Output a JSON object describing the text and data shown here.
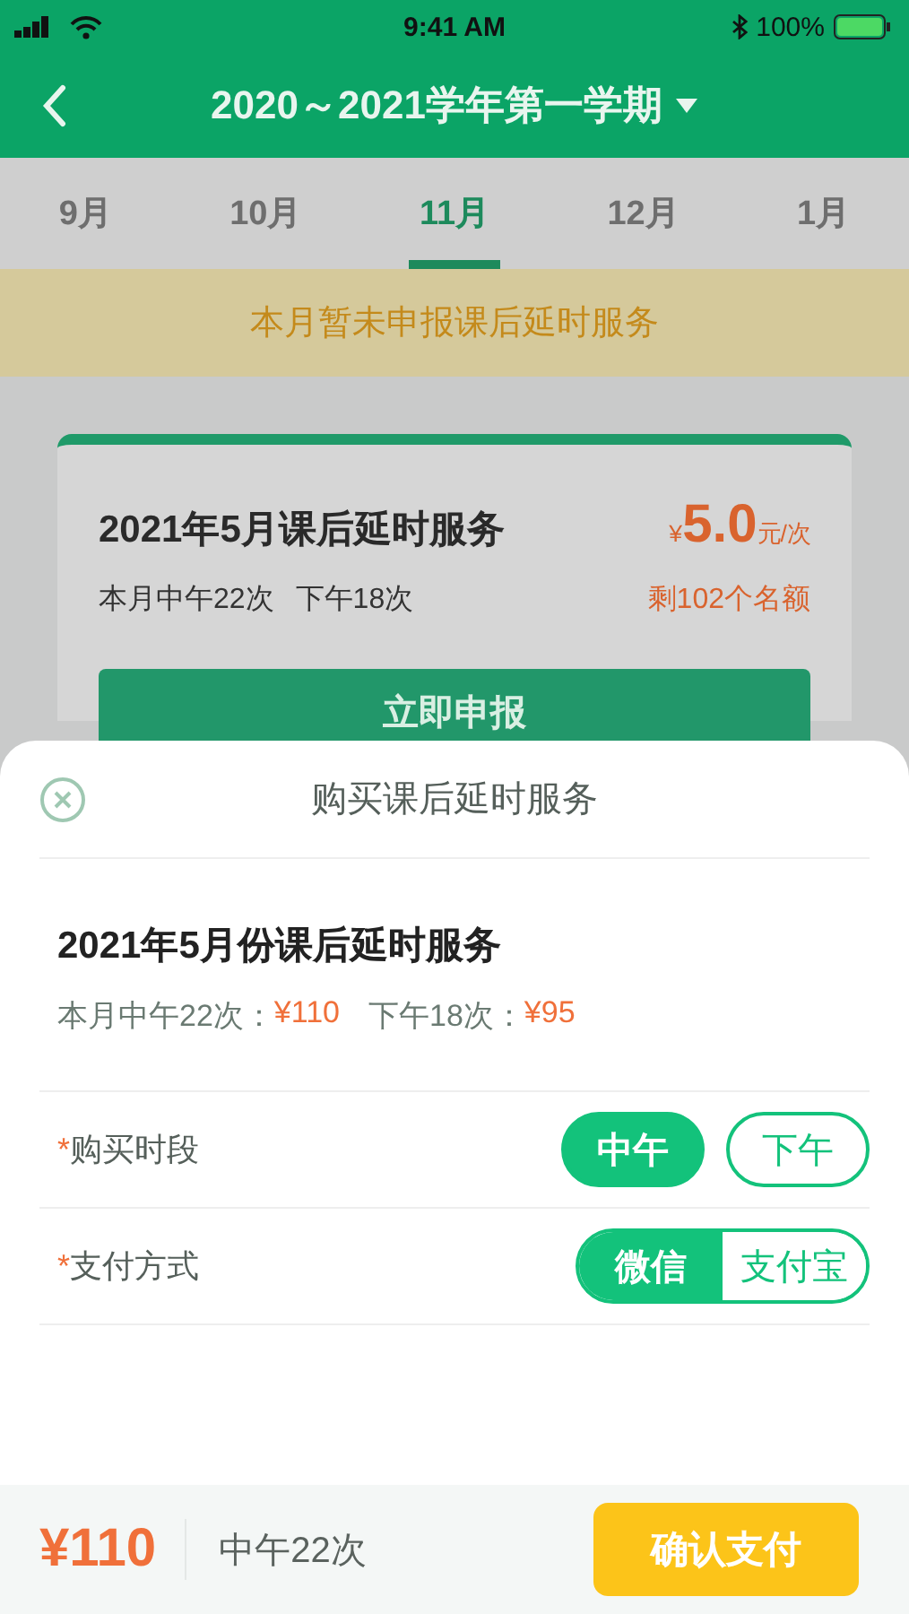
{
  "status_bar": {
    "time": "9:41 AM",
    "battery": "100%"
  },
  "header": {
    "title": "2020～2021学年第一学期"
  },
  "tabs": [
    {
      "label": "9月",
      "selected": false
    },
    {
      "label": "10月",
      "selected": false
    },
    {
      "label": "11月",
      "selected": true
    },
    {
      "label": "12月",
      "selected": false
    },
    {
      "label": "1月",
      "selected": false
    }
  ],
  "notice": "本月暂未申报课后延时服务",
  "card": {
    "title": "2021年5月课后延时服务",
    "currency": "¥",
    "amount": "5.0",
    "unit": "元/次",
    "counts": [
      "本月中午22次",
      "下午18次"
    ],
    "remaining": "剩102个名额",
    "button": "立即申报"
  },
  "sheet": {
    "title": "购买课后延时服务",
    "item_title": "2021年5月份课后延时服务",
    "prices": [
      {
        "label": "本月中午22次：",
        "value": "¥110"
      },
      {
        "label": "下午18次：",
        "value": "¥95"
      }
    ],
    "rows": [
      {
        "kind": "pills",
        "required_mark": "*",
        "label": "购买时段",
        "options": [
          {
            "label": "中午",
            "selected": true
          },
          {
            "label": "下午",
            "selected": false
          }
        ]
      },
      {
        "kind": "segmented",
        "required_mark": "*",
        "label": "支付方式",
        "options": [
          {
            "label": "微信",
            "selected": true
          },
          {
            "label": "支付宝",
            "selected": false
          }
        ]
      }
    ]
  },
  "footer": {
    "total": "¥110",
    "summary": "中午22次",
    "button": "确认支付"
  }
}
